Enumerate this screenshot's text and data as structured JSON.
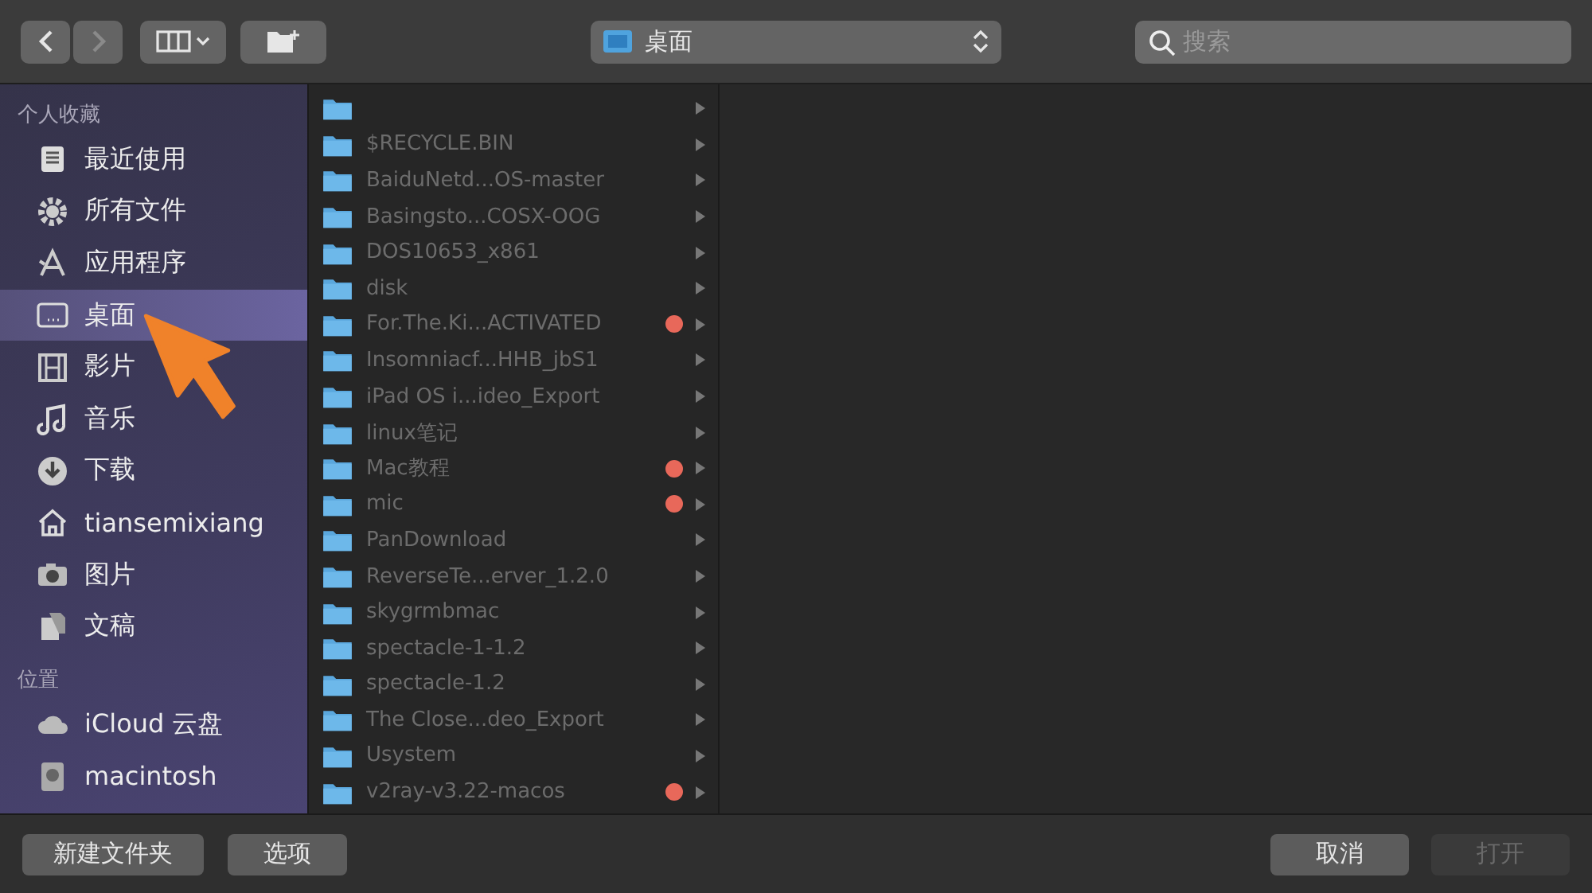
{
  "toolbar": {
    "back": {
      "disabled": false
    },
    "forward": {
      "disabled": true
    },
    "location": "桌面",
    "search": {
      "placeholder": "搜索"
    }
  },
  "sidebar": {
    "sections": [
      {
        "title": "个人收藏",
        "items": [
          {
            "label": "最近使用",
            "selected": false
          },
          {
            "label": "所有文件",
            "selected": false
          },
          {
            "label": "应用程序",
            "selected": false
          },
          {
            "label": "桌面",
            "selected": true
          },
          {
            "label": "影片",
            "selected": false
          },
          {
            "label": "音乐",
            "selected": false
          },
          {
            "label": "下载",
            "selected": false
          },
          {
            "label": "tiansemixiang",
            "selected": false
          },
          {
            "label": "图片",
            "selected": false
          },
          {
            "label": "文稿",
            "selected": false
          }
        ]
      },
      {
        "title": "位置",
        "items": [
          {
            "label": "iCloud 云盘",
            "selected": false
          },
          {
            "label": "macintosh",
            "selected": false
          }
        ]
      }
    ]
  },
  "files": [
    {
      "kind": "folder"
    },
    {
      "kind": "folder",
      "name": "$RECYCLE.BIN"
    },
    {
      "kind": "folder",
      "name": "BaiduNetd...OS-master"
    },
    {
      "kind": "folder",
      "name": "Basingsto...COSX-OOG"
    },
    {
      "kind": "folder",
      "name": "DOS10653_x861"
    },
    {
      "kind": "folder",
      "name": "disk"
    },
    {
      "kind": "folder",
      "name": "For.The.Ki...ACTIVATED",
      "color": "#e8685a"
    },
    {
      "kind": "folder",
      "name": "Insomniacf...HHB_jbS1"
    },
    {
      "kind": "folder",
      "name": "iPad OS i...ideo_Export"
    },
    {
      "kind": "folder",
      "name": "linux笔记"
    },
    {
      "kind": "folder",
      "name": "Mac教程",
      "color": "#e8685a"
    },
    {
      "kind": "folder",
      "name": "mic",
      "color": "#e8685a"
    },
    {
      "kind": "folder",
      "name": "PanDownload"
    },
    {
      "kind": "folder",
      "name": "ReverseTe...erver_1.2.0"
    },
    {
      "kind": "folder",
      "name": "skygrmbmac"
    },
    {
      "kind": "folder",
      "name": "spectacle-1-1.2"
    },
    {
      "kind": "folder",
      "name": "spectacle-1.2"
    },
    {
      "kind": "folder",
      "name": "The Close...deo_Export"
    },
    {
      "kind": "folder",
      "name": "Usystem"
    },
    {
      "kind": "folder",
      "name": "v2ray-v3.22-macos",
      "color": "#e8685a"
    }
  ],
  "footer": {
    "left_buttons": [
      {
        "label": "新建文件夹",
        "disabled": false
      },
      {
        "label": "选项",
        "disabled": false
      }
    ],
    "right_buttons": [
      {
        "label": "取消",
        "disabled": false
      },
      {
        "label": "打开",
        "disabled": true
      }
    ]
  }
}
